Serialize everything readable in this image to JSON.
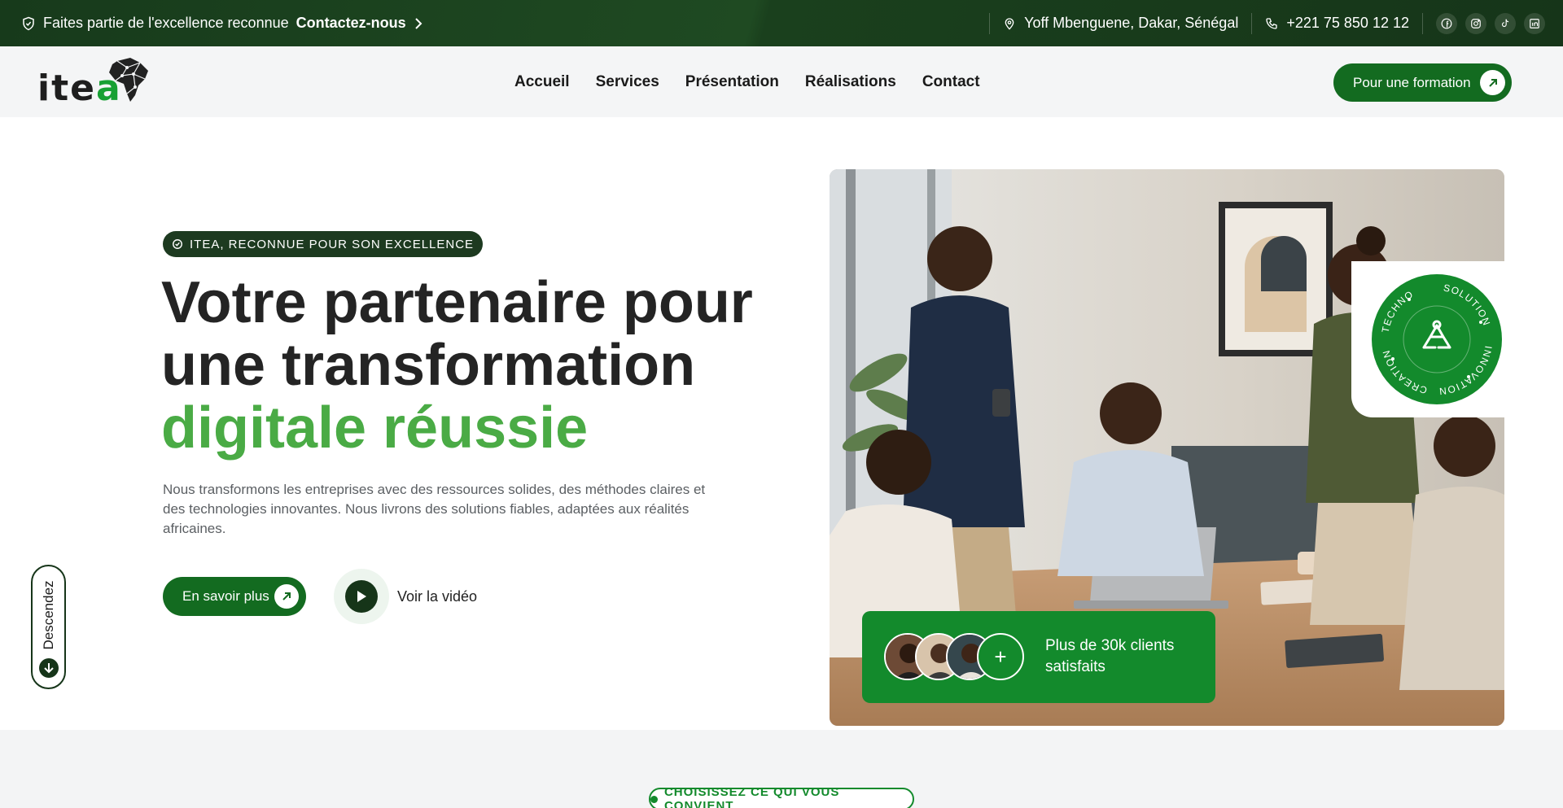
{
  "topbar": {
    "intro": "Faites partie de l'excellence reconnue",
    "contact_link": "Contactez-nous",
    "address": "Yoff Mbenguene, Dakar, Sénégal",
    "phone": "+221 75 850 12 12",
    "social_icons": [
      "facebook-icon",
      "instagram-icon",
      "tiktok-icon",
      "linkedin-icon"
    ]
  },
  "header": {
    "logo_text_main": "ite",
    "logo_text_accent": "a",
    "nav": [
      "Accueil",
      "Services",
      "Présentation",
      "Réalisations",
      "Contact"
    ],
    "cta": "Pour une formation"
  },
  "hero": {
    "badge": "ITEA, RECONNUE POUR SON EXCELLENCE",
    "title_line1": "Votre partenaire pour",
    "title_line2": "une transformation",
    "title_line3": "digitale réussie",
    "lead": "Nous transformons les entreprises avec des ressources solides, des méthodes claires et des technologies innovantes. Nous livrons des solutions fiables, adaptées aux réalités africaines.",
    "btn_more": "En savoir plus",
    "video_label": "Voir la vidéo",
    "scroll_label": "Descendez"
  },
  "seal": {
    "words": [
      "SOLUTION",
      "INNOVATION",
      "CREATION",
      "TECHNO"
    ]
  },
  "clients_card": {
    "text": "Plus de 30k clients satisfaits",
    "plus": "+"
  },
  "next_section": {
    "badge": "CHOISISSEZ CE QUI VOUS CONVIENT"
  },
  "colors": {
    "dark_green": "#163519",
    "brand_green": "#138a2c",
    "accent_green": "#4aab45"
  }
}
